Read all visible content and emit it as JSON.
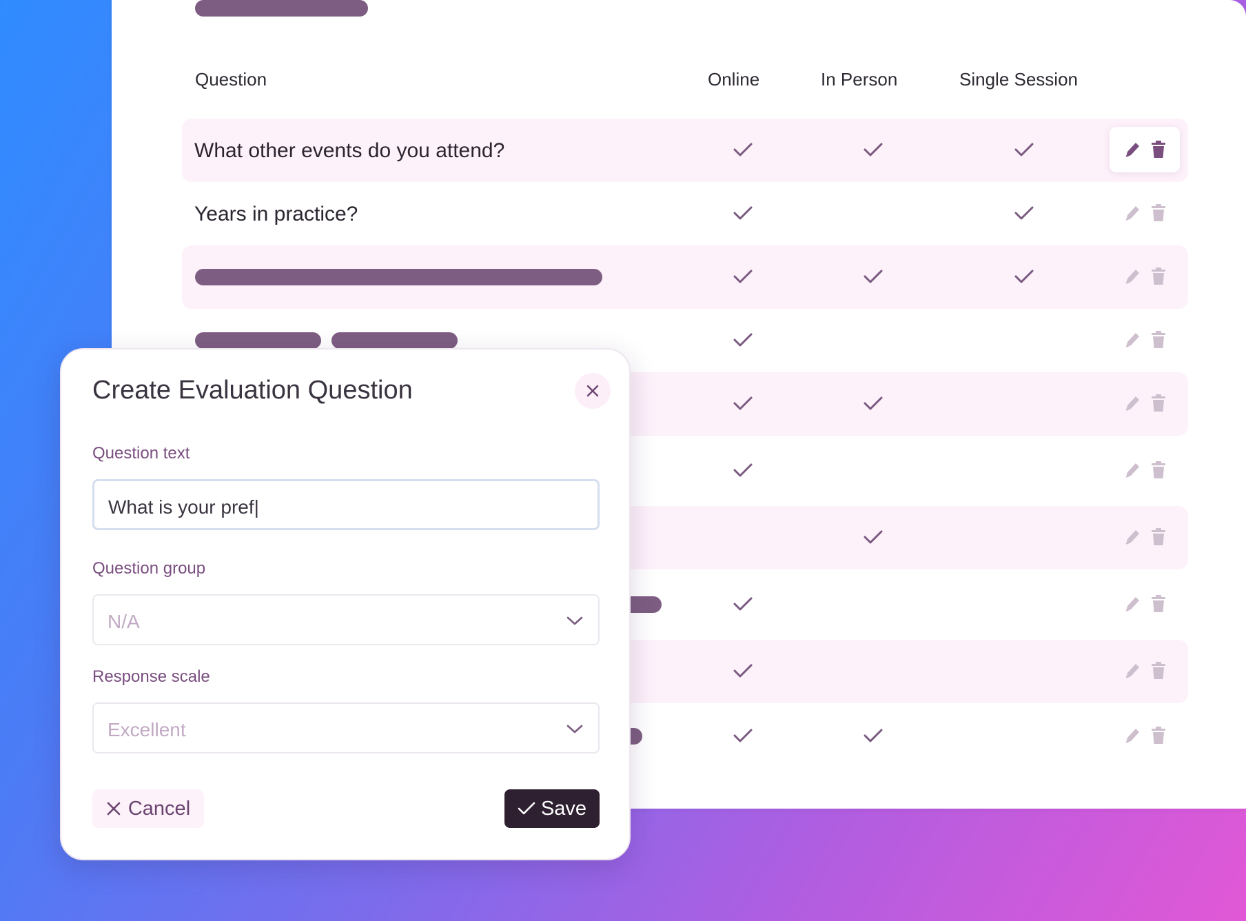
{
  "table": {
    "columns": {
      "question": "Question",
      "online": "Online",
      "in_person": "In Person",
      "single_session": "Single Session"
    },
    "rows": [
      {
        "text": "What other events do you attend?",
        "online": true,
        "in_person": true,
        "single_session": true
      },
      {
        "text": "Years in practice?",
        "online": true,
        "in_person": false,
        "single_session": true
      },
      {
        "text": "",
        "online": true,
        "in_person": true,
        "single_session": true
      },
      {
        "text": "",
        "online": true,
        "in_person": false,
        "single_session": false
      },
      {
        "text": "",
        "online": true,
        "in_person": true,
        "single_session": false
      },
      {
        "text": "",
        "online": true,
        "in_person": false,
        "single_session": false
      },
      {
        "text": "",
        "online": false,
        "in_person": true,
        "single_session": false
      },
      {
        "text": "",
        "online": true,
        "in_person": false,
        "single_session": false
      },
      {
        "text": "",
        "online": true,
        "in_person": false,
        "single_session": false
      },
      {
        "text": "",
        "online": true,
        "in_person": true,
        "single_session": false
      }
    ]
  },
  "modal": {
    "title": "Create Evaluation Question",
    "question_text": {
      "label": "Question text",
      "value": "What is your pref|"
    },
    "question_group": {
      "label": "Question group",
      "value": "N/A"
    },
    "response_scale": {
      "label": "Response scale",
      "value": "Excellent"
    },
    "cancel_label": "Cancel",
    "save_label": "Save"
  },
  "colors": {
    "accent": "#7d5e82",
    "row_shade": "#fdf1fa",
    "save_button": "#2e1f31"
  },
  "icons": {
    "edit": "pencil-icon",
    "delete": "trash-icon",
    "check": "check-icon",
    "close": "close-icon",
    "dropdown": "chevron-down-icon"
  }
}
